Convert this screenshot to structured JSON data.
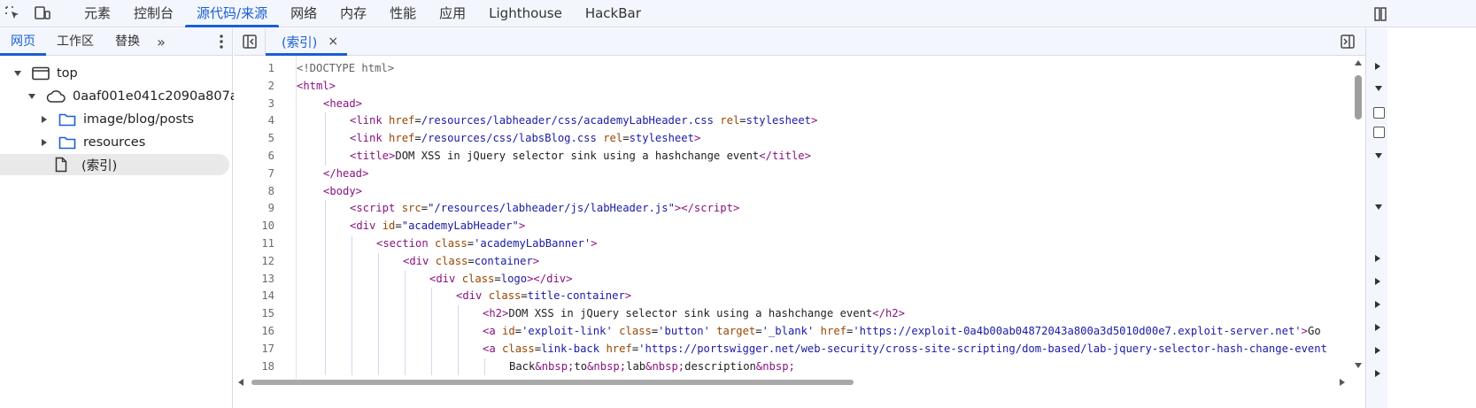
{
  "top_tabs": [
    "元素",
    "控制台",
    "源代码/来源",
    "网络",
    "内存",
    "性能",
    "应用",
    "Lighthouse",
    "HackBar"
  ],
  "active_top_tab": "源代码/来源",
  "navigator": {
    "tabs": [
      "网页",
      "工作区",
      "替换"
    ],
    "more": "»"
  },
  "tree": {
    "top": "top",
    "origin": "0aaf001e041c2090a807a...",
    "folder1": "image/blog/posts",
    "folder2": "resources",
    "file": "(索引)"
  },
  "editor": {
    "file_tab": "(索引)",
    "close": "×",
    "lines": [
      {
        "n": "1",
        "i": 0,
        "h": "<span class='t-cmt'>&lt;!DOCTYPE html&gt;</span>"
      },
      {
        "n": "2",
        "i": 0,
        "h": "<span class='t-tag'>&lt;html&gt;</span>"
      },
      {
        "n": "3",
        "i": 1,
        "h": "<span class='t-tag'>&lt;head&gt;</span>"
      },
      {
        "n": "4",
        "i": 2,
        "h": "<span class='t-tag'>&lt;link</span> <span class='t-att'>href</span>=<span class='t-val'>/resources/labheader/css/academyLabHeader.css</span> <span class='t-att'>rel</span>=<span class='t-val'>stylesheet</span><span class='t-tag'>&gt;</span>"
      },
      {
        "n": "5",
        "i": 2,
        "h": "<span class='t-tag'>&lt;link</span> <span class='t-att'>href</span>=<span class='t-val'>/resources/css/labsBlog.css</span> <span class='t-att'>rel</span>=<span class='t-val'>stylesheet</span><span class='t-tag'>&gt;</span>"
      },
      {
        "n": "6",
        "i": 2,
        "h": "<span class='t-tag'>&lt;title&gt;</span>DOM XSS in jQuery selector sink using a hashchange event<span class='t-tag'>&lt;/title&gt;</span>"
      },
      {
        "n": "7",
        "i": 1,
        "h": "<span class='t-tag'>&lt;/head&gt;</span>"
      },
      {
        "n": "8",
        "i": 1,
        "h": "<span class='t-tag'>&lt;body&gt;</span>"
      },
      {
        "n": "9",
        "i": 2,
        "h": "<span class='t-tag'>&lt;script</span> <span class='t-att'>src</span>=<span class='t-val'>\"/resources/labheader/js/labHeader.js\"</span><span class='t-tag'>&gt;&lt;/script&gt;</span>"
      },
      {
        "n": "10",
        "i": 2,
        "h": "<span class='t-tag'>&lt;div</span> <span class='t-att'>id</span>=<span class='t-val'>\"academyLabHeader\"</span><span class='t-tag'>&gt;</span>"
      },
      {
        "n": "11",
        "i": 3,
        "h": "<span class='t-tag'>&lt;section</span> <span class='t-att'>class</span>=<span class='t-val'>'academyLabBanner'</span><span class='t-tag'>&gt;</span>"
      },
      {
        "n": "12",
        "i": 4,
        "h": "<span class='t-tag'>&lt;div</span> <span class='t-att'>class</span>=<span class='t-val'>container</span><span class='t-tag'>&gt;</span>"
      },
      {
        "n": "13",
        "i": 5,
        "h": "<span class='t-tag'>&lt;div</span> <span class='t-att'>class</span>=<span class='t-val'>logo</span><span class='t-tag'>&gt;&lt;/div&gt;</span>"
      },
      {
        "n": "14",
        "i": 6,
        "h": "<span class='t-tag'>&lt;div</span> <span class='t-att'>class</span>=<span class='t-val'>title-container</span><span class='t-tag'>&gt;</span>"
      },
      {
        "n": "15",
        "i": 7,
        "h": "<span class='t-tag'>&lt;h2&gt;</span>DOM XSS in jQuery selector sink using a hashchange event<span class='t-tag'>&lt;/h2&gt;</span>"
      },
      {
        "n": "16",
        "i": 7,
        "h": "<span class='t-tag'>&lt;a</span> <span class='t-att'>id</span>=<span class='t-val'>'exploit-link'</span> <span class='t-att'>class</span>=<span class='t-val'>'button'</span> <span class='t-att'>target</span>=<span class='t-val'>'_blank'</span> <span class='t-att'>href</span>=<span class='t-val'>'https://exploit-0a4b00ab04872043a800a3d5010d00e7.exploit-server.net'</span><span class='t-tag'>&gt;</span>Go"
      },
      {
        "n": "17",
        "i": 7,
        "h": "<span class='t-tag'>&lt;a</span> <span class='t-att'>class</span>=<span class='t-val'>link-back</span> <span class='t-att'>href</span>=<span class='t-val'>'https://portswigger.net/web-security/cross-site-scripting/dom-based/lab-jquery-selector-hash-change-event</span>"
      },
      {
        "n": "18",
        "i": 8,
        "h": "Back<span class='t-ent'>&amp;nbsp;</span>to<span class='t-ent'>&amp;nbsp;</span>lab<span class='t-ent'>&amp;nbsp;</span>description<span class='t-ent'>&amp;nbsp;</span>"
      }
    ]
  },
  "colors": {
    "accent": "#1a5fd1",
    "tag": "#881280",
    "attr": "#994500",
    "value": "#1a1aa6"
  }
}
